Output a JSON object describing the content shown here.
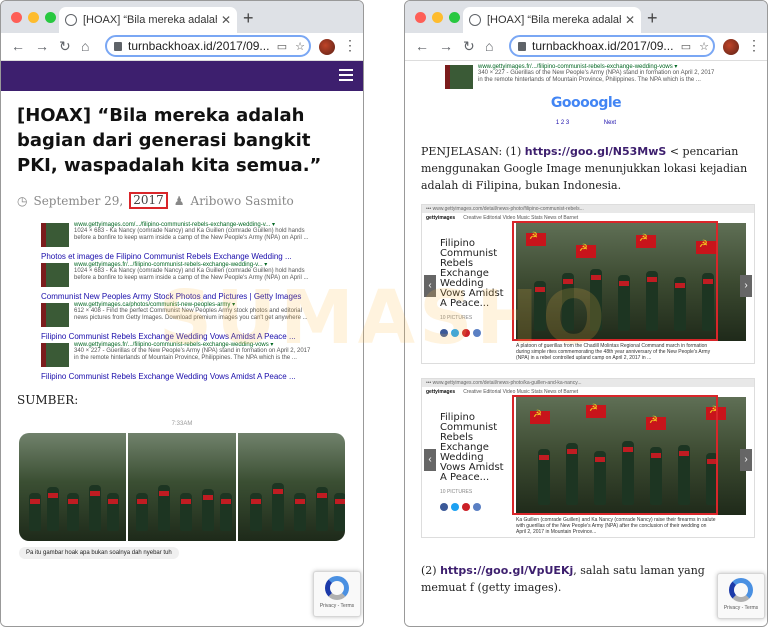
{
  "watermark": "SUMASHO",
  "browser": {
    "tab_title": "[HOAX] “Bila mereka adalah ba",
    "url": "turnbackhoax.id/2017/09..."
  },
  "article": {
    "headline": "[HOAX] “Bila mereka adalah bagian dari generasi bangkit PKI, waspadalah kita semua.”",
    "date_text": "September 29,",
    "year": "2017",
    "author": "Aribowo Sasmito",
    "sumber_label": "SUMBER:",
    "chat_time": "7:33AM",
    "chat_caption": "Pa itu gambar hoak apa bukan soalnya dah nyebar tuh"
  },
  "search_results": [
    {
      "title": "",
      "url": "www.gettyimages.com/.../filipino-communist-rebels-exchange-wedding-v... ▾",
      "snippet": "1024 × 683 - Ka Nancy (comrade Nancy) and Ka Guillen (comrade Guillen) hold hands before a bonfire to keep warm inside a camp of the New People's Army (NPA) on April ..."
    },
    {
      "title": "Photos et images de Filipino Communist Rebels Exchange Wedding ...",
      "url": "www.gettyimages.fr/.../filipino-communist-rebels-exchange-wedding-v... ▾",
      "snippet": "1024 × 683 - Ka Nancy (comrade Nancy) and Ka Guillen (comrade Guillen) hold hands before a bonfire to keep warm inside a camp of the New People's Army (NPA) on April ..."
    },
    {
      "title": "Communist New Peoples Army Stock Photos and Pictures | Getty Images",
      "url": "www.gettyimages.ca/photos/communist-new-peoples-army ▾",
      "snippet": "612 × 408 - Find the perfect Communist New Peoples Army stock photos and editorial news pictures from Getty Images. Download premium images you can't get anywhere ..."
    },
    {
      "title": "Filipino Communist Rebels Exchange Wedding Vows Amidst A Peace ...",
      "url": "www.gettyimages.fr/.../filipino-communist-rebels-exchange-wedding-vows ▾",
      "snippet": "340 × 227 - Guerillas of the New People's Army (NPA) stand in formation on April 2, 2017 in the remote hinterlands of Mountain Province, Philippines. The NPA which is the ..."
    },
    {
      "title": "Filipino Communist Rebels Exchange Wedding Vows Amidst A Peace ...",
      "url": "",
      "snippet": ""
    }
  ],
  "right": {
    "top_result": {
      "url": "www.gettyimages.fr/.../filipino-communist-rebels-exchange-wedding-vows ▾",
      "snippet": "340 × 227 - Guerillas of the New People's Army (NPA) stand in formation on April 2, 2017 in the remote hinterlands of Mountain Province, Philippines. The NPA which is the ..."
    },
    "google_word": "Goooogle",
    "pages": "1 2 3",
    "next": "Next",
    "penjelasan_prefix": "PENJELASAN: (1) ",
    "link1": "https://goo.gl/N53MwS",
    "penjelasan_text": " < pencarian menggunakan Google Image menunjukkan lokasi kejadian adalah di Filipina, bukan Indonesia.",
    "shot_logo": "gettyimages",
    "shot_nav": "Creative  Editorial  Video  Music  Stats  News of Barnet",
    "shot_title": "Filipino Communist Rebels Exchange Wedding Vows Amidst A Peace...",
    "shot_meta": "10 PICTURES",
    "shot1_caption": "A platoon of guerillas from the Chadill Molintas Regional Command march in formation during simple rites commemorating the 48th year anniversary of the New People's Army (NPA) in a rebel controlled upland camp on April 2, 2017 in ...",
    "shot2_caption": "Ka Guillen (comrade Guillen) and Ka Nancy (comrade Nancy) raise their firearms in salute with guerillas of the New People's Army (NPA) after the conclusion of their wedding on April 2, 2017 in Mountain Province...",
    "para2_prefix": "(2) ",
    "link2": "https://goo.gl/VpUEKj",
    "para2_text": ", salah satu laman yang memuat f (getty images)."
  },
  "captcha": "Privacy - Terms",
  "colors": {
    "accent_purple": "#3d1f6e",
    "highlight_red": "#d9262a"
  }
}
